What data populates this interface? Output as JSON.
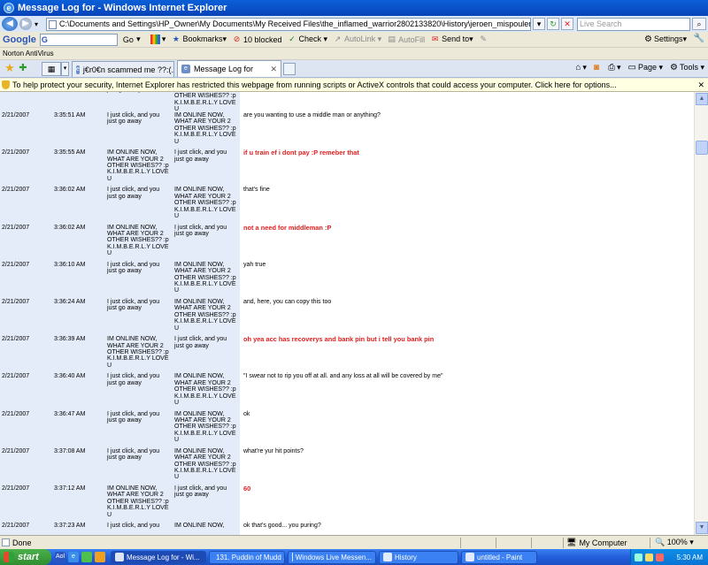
{
  "window": {
    "title": "Message Log for - Windows Internet Explorer"
  },
  "address": {
    "url": "C:\\Documents and Settings\\HP_Owner\\My Documents\\My Received Files\\the_inflamed_warrior2802133820\\History\\jeroen_mispouler193143870.xml",
    "search_placeholder": "Live Search"
  },
  "google": {
    "logo": "Google",
    "go": "Go",
    "bookmarks": "Bookmarks▾",
    "blocked": "10 blocked",
    "check": "Check ▾",
    "autolink": "AutoLink ▾",
    "autofill": "AutoFill",
    "sendto": "Send to▾",
    "settings": "Settings▾"
  },
  "norton": {
    "label": "Norton AntiVirus"
  },
  "tabs": [
    {
      "label": "j€r0€n scammed me ??:(... - ..."
    },
    {
      "label": "Message Log for"
    }
  ],
  "commands": {
    "page": "Page ▾",
    "tools": "Tools ▾"
  },
  "infobar": {
    "text": "To help protect your security, Internet Explorer has restricted this webpage from running scripts or ActiveX controls that could access your computer. Click here for options..."
  },
  "log": {
    "top_partial": {
      "from": "just go away",
      "to": "WHAT ARE YOUR 2\nOTHER WISHES?? :p\nK.I.M.B.E.R.L.Y LOVE\nU"
    },
    "rows": [
      {
        "date": "2/21/2007",
        "time": "3:35:51 AM",
        "from": "I just click, and you\njust go away",
        "to": "IM ONLINE NOW,\nWHAT ARE YOUR 2\nOTHER WISHES?? :p\nK.I.M.B.E.R.L.Y LOVE\nU",
        "msg": "are you wanting to use a middle man or anything?",
        "red": false
      },
      {
        "date": "2/21/2007",
        "time": "3:35:55 AM",
        "from": "IM ONLINE NOW,\nWHAT ARE YOUR 2\nOTHER WISHES?? :p\nK.I.M.B.E.R.L.Y LOVE\nU",
        "to": "I just click, and you\njust go away",
        "msg": "if u train ef i dont pay :P remeber that",
        "red": true
      },
      {
        "date": "2/21/2007",
        "time": "3:36:02 AM",
        "from": "I just click, and you\njust go away",
        "to": "IM ONLINE NOW,\nWHAT ARE YOUR 2\nOTHER WISHES?? :p\nK.I.M.B.E.R.L.Y LOVE\nU",
        "msg": "that's fine",
        "red": false
      },
      {
        "date": "2/21/2007",
        "time": "3:36:02 AM",
        "from": "IM ONLINE NOW,\nWHAT ARE YOUR 2\nOTHER WISHES?? :p\nK.I.M.B.E.R.L.Y LOVE\nU",
        "to": "I just click, and you\njust go away",
        "msg": "not a need for middleman :P",
        "red": true
      },
      {
        "date": "2/21/2007",
        "time": "3:36:10 AM",
        "from": "I just click, and you\njust go away",
        "to": "IM ONLINE NOW,\nWHAT ARE YOUR 2\nOTHER WISHES?? :p\nK.I.M.B.E.R.L.Y LOVE\nU",
        "msg": "yah true",
        "red": false
      },
      {
        "date": "2/21/2007",
        "time": "3:36:24 AM",
        "from": "I just click, and you\njust go away",
        "to": "IM ONLINE NOW,\nWHAT ARE YOUR 2\nOTHER WISHES?? :p\nK.I.M.B.E.R.L.Y LOVE\nU",
        "msg": "and, here, you can copy this too",
        "red": false
      },
      {
        "date": "2/21/2007",
        "time": "3:36:39 AM",
        "from": "IM ONLINE NOW,\nWHAT ARE YOUR 2\nOTHER WISHES?? :p\nK.I.M.B.E.R.L.Y LOVE\nU",
        "to": "I just click, and you\njust go away",
        "msg": "oh yea acc has recoverys and bank pin but i tell you bank pin",
        "red": true
      },
      {
        "date": "2/21/2007",
        "time": "3:36:40 AM",
        "from": "I just click, and you\njust go away",
        "to": "IM ONLINE NOW,\nWHAT ARE YOUR 2\nOTHER WISHES?? :p\nK.I.M.B.E.R.L.Y LOVE\nU",
        "msg": "\"I swear not to rip you off at all. and any loss at all will be covered by me\"",
        "red": false
      },
      {
        "date": "2/21/2007",
        "time": "3:36:47 AM",
        "from": "I just click, and you\njust go away",
        "to": "IM ONLINE NOW,\nWHAT ARE YOUR 2\nOTHER WISHES?? :p\nK.I.M.B.E.R.L.Y LOVE\nU",
        "msg": "ok",
        "red": false
      },
      {
        "date": "2/21/2007",
        "time": "3:37:08 AM",
        "from": "I just click, and you\njust go away",
        "to": "IM ONLINE NOW,\nWHAT ARE YOUR 2\nOTHER WISHES?? :p\nK.I.M.B.E.R.L.Y LOVE\nU",
        "msg": "what're yur hit points?",
        "red": false
      },
      {
        "date": "2/21/2007",
        "time": "3:37:12 AM",
        "from": "IM ONLINE NOW,\nWHAT ARE YOUR 2\nOTHER WISHES?? :p\nK.I.M.B.E.R.L.Y LOVE\nU",
        "to": "I just click, and you\njust go away",
        "msg": "60",
        "red": true
      },
      {
        "date": "2/21/2007",
        "time": "3:37:23 AM",
        "from": "I just click, and you",
        "to": "IM ONLINE NOW,",
        "msg": "ok that's good... you puring?",
        "red": false
      }
    ]
  },
  "status": {
    "text": "Done",
    "zone": "My Computer",
    "zoom": "100%"
  },
  "taskbar": {
    "start": "start",
    "buttons": [
      {
        "label": "Message Log for - Wi..."
      },
      {
        "label": "131. Puddin of Mudd ..."
      },
      {
        "label": "Windows Live Messen..."
      },
      {
        "label": "History"
      },
      {
        "label": "untitled - Paint"
      }
    ],
    "clock": "5:30 AM"
  },
  "colors": {
    "accent_red": "#e21d1d",
    "log_bg": "#e4ecf9",
    "titlebar": "#0843b8"
  }
}
